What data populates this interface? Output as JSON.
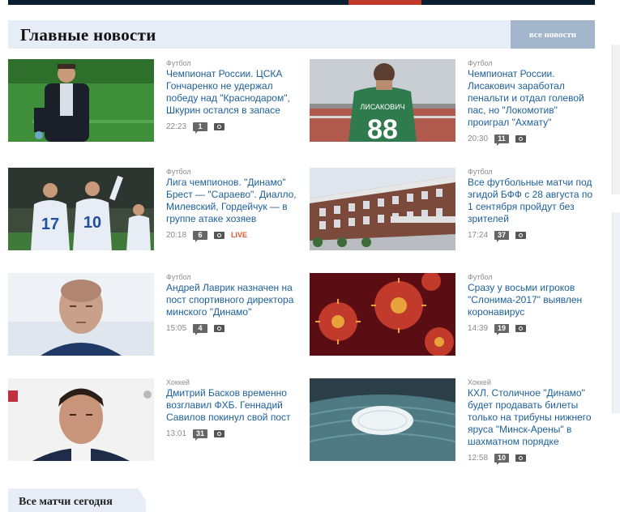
{
  "section": {
    "title": "Главные новости",
    "all_news": "все новости"
  },
  "matches_tab": "Все матчи сегодня",
  "news": [
    {
      "category": "Футбол",
      "title": "Чемпионат России. ЦСКА Гончаренко не удержал победу над \"Краснодаром\", Шкурин остался в запасе",
      "time": "22:23",
      "comments": "1",
      "has_photo": true
    },
    {
      "category": "Футбол",
      "title": "Чемпионат России. Лисакович заработал пенальти и отдал голевой пас, но \"Локомотив\" проиграл \"Ахмату\"",
      "time": "20:30",
      "comments": "11",
      "has_photo": true
    },
    {
      "category": "Футбол",
      "title": "Лига чемпионов. \"Динамо\" Брест — \"Сараево\". Диалло, Милевский, Гордейчук — в группе атаке хозяев",
      "time": "20:18",
      "comments": "6",
      "has_photo": true,
      "live": "LIVE"
    },
    {
      "category": "Футбол",
      "title": "Все футбольные матчи под эгидой БФФ с 28 августа по 1 сентября пройдут без зрителей",
      "time": "17:24",
      "comments": "37",
      "has_photo": true
    },
    {
      "category": "Футбол",
      "title": "Андрей Лаврик назначен на пост спортивного директора минского \"Динамо\"",
      "time": "15:05",
      "comments": "4",
      "has_photo": true
    },
    {
      "category": "Футбол",
      "title": "Сразу у восьми игроков \"Слонима-2017\" выявлен коронавирус",
      "time": "14:39",
      "comments": "19",
      "has_photo": true
    },
    {
      "category": "Хоккей",
      "title": "Дмитрий Басков временно возглавил ФХБ. Геннадий Савилов покинул свой пост",
      "time": "13:01",
      "comments": "31",
      "has_photo": true
    },
    {
      "category": "Хоккей",
      "title": "КХЛ. Столичное \"Динамо\" будет продавать билеты только на трибуны нижнего яруса \"Минск-Арены\" в шахматном порядке",
      "time": "12:58",
      "comments": "10",
      "has_photo": true
    }
  ],
  "image_names": [
    "coach-photo",
    "player-88-photo",
    "players-photo",
    "stadium-building-photo",
    "lavrik-photo",
    "coronavirus-photo",
    "baskov-photo",
    "arena-photo"
  ],
  "colors": {
    "link": "#1c5f9a",
    "header_bg": "#e6edf6",
    "button_bg": "#a3b5cb",
    "live": "#e8542a"
  }
}
